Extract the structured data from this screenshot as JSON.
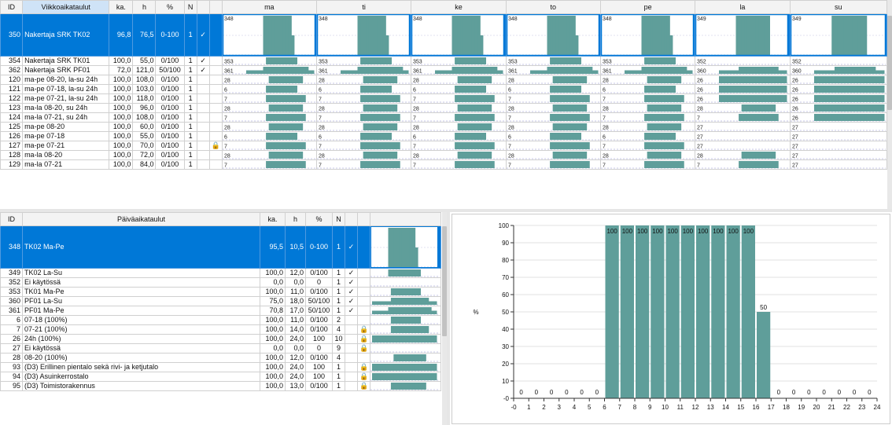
{
  "weekly": {
    "headers": {
      "id": "ID",
      "name": "Viikkoaikataulut",
      "ka": "ka.",
      "h": "h",
      "pct": "%",
      "n": "N"
    },
    "days": [
      "ma",
      "ti",
      "ke",
      "to",
      "pe",
      "la",
      "su"
    ],
    "rows": [
      {
        "id": "350",
        "name": "Nakertaja SRK TK02",
        "ka": "96,8",
        "h": "76,5",
        "pct": "0-100",
        "n": "1",
        "check": "✓",
        "lock": "",
        "dayIds": [
          "348",
          "348",
          "348",
          "348",
          "348",
          "349",
          "349"
        ],
        "patterns": [
          "tk02mp",
          "tk02mp",
          "tk02mp",
          "tk02mp",
          "tk02mp",
          "tk02ls",
          "tk02ls"
        ],
        "selected": true
      },
      {
        "id": "354",
        "name": "Nakertaja SRK TK01",
        "ka": "100,0",
        "h": "55,0",
        "pct": "0/100",
        "n": "1",
        "check": "✓",
        "lock": "",
        "dayIds": [
          "353",
          "353",
          "353",
          "353",
          "353",
          "352",
          "352"
        ],
        "patterns": [
          "tk01",
          "tk01",
          "tk01",
          "tk01",
          "tk01",
          "none",
          "none"
        ]
      },
      {
        "id": "362",
        "name": "Nakertaja SRK PF01",
        "ka": "72,0",
        "h": "121,0",
        "pct": "50/100",
        "n": "1",
        "check": "✓",
        "lock": "",
        "dayIds": [
          "361",
          "361",
          "361",
          "361",
          "361",
          "360",
          "360"
        ],
        "patterns": [
          "pf01mp",
          "pf01mp",
          "pf01mp",
          "pf01mp",
          "pf01mp",
          "pf01ls",
          "pf01ls"
        ]
      },
      {
        "id": "120",
        "name": "ma-pe 08-20, la-su 24h",
        "ka": "100,0",
        "h": "108,0",
        "pct": "0/100",
        "n": "1",
        "check": "",
        "lock": "",
        "dayIds": [
          "28",
          "28",
          "28",
          "28",
          "28",
          "26",
          "26"
        ],
        "patterns": [
          "h0820",
          "h0820",
          "h0820",
          "h0820",
          "h0820",
          "full",
          "full"
        ]
      },
      {
        "id": "121",
        "name": "ma-pe 07-18, la-su 24h",
        "ka": "100,0",
        "h": "103,0",
        "pct": "0/100",
        "n": "1",
        "check": "",
        "lock": "",
        "dayIds": [
          "6",
          "6",
          "6",
          "6",
          "6",
          "26",
          "26"
        ],
        "patterns": [
          "h0718",
          "h0718",
          "h0718",
          "h0718",
          "h0718",
          "full",
          "full"
        ]
      },
      {
        "id": "122",
        "name": "ma-pe 07-21, la-su 24h",
        "ka": "100,0",
        "h": "118,0",
        "pct": "0/100",
        "n": "1",
        "check": "",
        "lock": "",
        "dayIds": [
          "7",
          "7",
          "7",
          "7",
          "7",
          "26",
          "26"
        ],
        "patterns": [
          "h0721",
          "h0721",
          "h0721",
          "h0721",
          "h0721",
          "full",
          "full"
        ]
      },
      {
        "id": "123",
        "name": "ma-la 08-20, su 24h",
        "ka": "100,0",
        "h": "96,0",
        "pct": "0/100",
        "n": "1",
        "check": "",
        "lock": "",
        "dayIds": [
          "28",
          "28",
          "28",
          "28",
          "28",
          "28",
          "26"
        ],
        "patterns": [
          "h0820",
          "h0820",
          "h0820",
          "h0820",
          "h0820",
          "h0820",
          "full"
        ]
      },
      {
        "id": "124",
        "name": "ma-la 07-21, su 24h",
        "ka": "100,0",
        "h": "108,0",
        "pct": "0/100",
        "n": "1",
        "check": "",
        "lock": "",
        "dayIds": [
          "7",
          "7",
          "7",
          "7",
          "7",
          "7",
          "26"
        ],
        "patterns": [
          "h0721",
          "h0721",
          "h0721",
          "h0721",
          "h0721",
          "h0721",
          "full"
        ]
      },
      {
        "id": "125",
        "name": "ma-pe 08-20",
        "ka": "100,0",
        "h": "60,0",
        "pct": "0/100",
        "n": "1",
        "check": "",
        "lock": "",
        "dayIds": [
          "28",
          "28",
          "28",
          "28",
          "28",
          "27",
          "27"
        ],
        "patterns": [
          "h0820",
          "h0820",
          "h0820",
          "h0820",
          "h0820",
          "none",
          "none"
        ]
      },
      {
        "id": "126",
        "name": "ma-pe 07-18",
        "ka": "100,0",
        "h": "55,0",
        "pct": "0/100",
        "n": "1",
        "check": "",
        "lock": "",
        "dayIds": [
          "6",
          "6",
          "6",
          "6",
          "6",
          "27",
          "27"
        ],
        "patterns": [
          "h0718",
          "h0718",
          "h0718",
          "h0718",
          "h0718",
          "none",
          "none"
        ]
      },
      {
        "id": "127",
        "name": "ma-pe 07-21",
        "ka": "100,0",
        "h": "70,0",
        "pct": "0/100",
        "n": "1",
        "check": "",
        "lock": "🔒",
        "dayIds": [
          "7",
          "7",
          "7",
          "7",
          "7",
          "27",
          "27"
        ],
        "patterns": [
          "h0721",
          "h0721",
          "h0721",
          "h0721",
          "h0721",
          "none",
          "none"
        ]
      },
      {
        "id": "128",
        "name": "ma-la 08-20",
        "ka": "100,0",
        "h": "72,0",
        "pct": "0/100",
        "n": "1",
        "check": "",
        "lock": "",
        "dayIds": [
          "28",
          "28",
          "28",
          "28",
          "28",
          "28",
          "27"
        ],
        "patterns": [
          "h0820",
          "h0820",
          "h0820",
          "h0820",
          "h0820",
          "h0820",
          "none"
        ]
      },
      {
        "id": "129",
        "name": "ma-la 07-21",
        "ka": "100,0",
        "h": "84,0",
        "pct": "0/100",
        "n": "1",
        "check": "",
        "lock": "",
        "dayIds": [
          "7",
          "7",
          "7",
          "7",
          "7",
          "7",
          "27"
        ],
        "patterns": [
          "h0721",
          "h0721",
          "h0721",
          "h0721",
          "h0721",
          "h0721",
          "none"
        ]
      }
    ]
  },
  "daily": {
    "headers": {
      "id": "ID",
      "name": "Päiväaikataulut",
      "ka": "ka.",
      "h": "h",
      "pct": "%",
      "n": "N"
    },
    "rows": [
      {
        "id": "348",
        "name": "TK02 Ma-Pe",
        "ka": "95,5",
        "h": "10,5",
        "pct": "0-100",
        "n": "1",
        "check": "✓",
        "lock": "",
        "pattern": "tk02mp",
        "selected": true
      },
      {
        "id": "349",
        "name": "TK02 La-Su",
        "ka": "100,0",
        "h": "12,0",
        "pct": "0/100",
        "n": "1",
        "check": "✓",
        "lock": "",
        "pattern": "tk02ls"
      },
      {
        "id": "352",
        "name": "Ei käytössä",
        "ka": "0,0",
        "h": "0,0",
        "pct": "0",
        "n": "1",
        "check": "✓",
        "lock": "",
        "pattern": "none"
      },
      {
        "id": "353",
        "name": "TK01 Ma-Pe",
        "ka": "100,0",
        "h": "11,0",
        "pct": "0/100",
        "n": "1",
        "check": "✓",
        "lock": "",
        "pattern": "tk01"
      },
      {
        "id": "360",
        "name": "PF01 La-Su",
        "ka": "75,0",
        "h": "18,0",
        "pct": "50/100",
        "n": "1",
        "check": "✓",
        "lock": "",
        "pattern": "pf01ls"
      },
      {
        "id": "361",
        "name": "PF01 Ma-Pe",
        "ka": "70,8",
        "h": "17,0",
        "pct": "50/100",
        "n": "1",
        "check": "✓",
        "lock": "",
        "pattern": "pf01mp"
      },
      {
        "id": "6",
        "name": "07-18 (100%)",
        "ka": "100,0",
        "h": "11,0",
        "pct": "0/100",
        "n": "2",
        "check": "",
        "lock": "",
        "pattern": "h0718"
      },
      {
        "id": "7",
        "name": "07-21 (100%)",
        "ka": "100,0",
        "h": "14,0",
        "pct": "0/100",
        "n": "4",
        "check": "",
        "lock": "🔒",
        "pattern": "h0721"
      },
      {
        "id": "26",
        "name": "24h (100%)",
        "ka": "100,0",
        "h": "24,0",
        "pct": "100",
        "n": "10",
        "check": "",
        "lock": "🔒",
        "pattern": "full"
      },
      {
        "id": "27",
        "name": "Ei käytössä",
        "ka": "0,0",
        "h": "0,0",
        "pct": "0",
        "n": "9",
        "check": "",
        "lock": "🔒",
        "pattern": "none"
      },
      {
        "id": "28",
        "name": "08-20 (100%)",
        "ka": "100,0",
        "h": "12,0",
        "pct": "0/100",
        "n": "4",
        "check": "",
        "lock": "",
        "pattern": "h0820"
      },
      {
        "id": "93",
        "name": "(D3) Erillinen pientalo sekä rivi- ja ketjutalo",
        "ka": "100,0",
        "h": "24,0",
        "pct": "100",
        "n": "1",
        "check": "",
        "lock": "🔒",
        "pattern": "full"
      },
      {
        "id": "94",
        "name": "(D3) Asuinkerrostalo",
        "ka": "100,0",
        "h": "24,0",
        "pct": "100",
        "n": "1",
        "check": "",
        "lock": "🔒",
        "pattern": "full"
      },
      {
        "id": "95",
        "name": "(D3) Toimistorakennus",
        "ka": "100,0",
        "h": "13,0",
        "pct": "0/100",
        "n": "1",
        "check": "",
        "lock": "🔒",
        "pattern": "h0720"
      }
    ]
  },
  "chart_data": {
    "type": "bar",
    "title": "",
    "xlabel": "",
    "ylabel": "%",
    "categories": [
      0,
      1,
      2,
      3,
      4,
      5,
      6,
      7,
      8,
      9,
      10,
      11,
      12,
      13,
      14,
      15,
      16,
      17,
      18,
      19,
      20,
      21,
      22,
      23
    ],
    "values": [
      0,
      0,
      0,
      0,
      0,
      0,
      100,
      100,
      100,
      100,
      100,
      100,
      100,
      100,
      100,
      100,
      50,
      0,
      0,
      0,
      0,
      0,
      0,
      0
    ],
    "xticks": [
      "-0",
      "1",
      "2",
      "3",
      "4",
      "5",
      "6",
      "7",
      "8",
      "9",
      "10",
      "11",
      "12",
      "13",
      "14",
      "15",
      "16",
      "17",
      "18",
      "19",
      "20",
      "21",
      "22",
      "23",
      "24"
    ],
    "yticks": [
      "-0",
      "10",
      "20",
      "30",
      "40",
      "50",
      "60",
      "70",
      "80",
      "90",
      "100"
    ],
    "xlim": [
      0,
      24
    ],
    "ylim": [
      0,
      100
    ],
    "grid": true,
    "color": "#5f9e9a"
  },
  "colors": {
    "bar": "#5f9e9a",
    "selected": "#0078d7",
    "headerHighlight": "#cfe3f7"
  },
  "patterns": {
    "tk02mp": [
      0,
      0,
      0,
      0,
      0,
      0,
      100,
      100,
      100,
      100,
      100,
      100,
      100,
      100,
      100,
      100,
      50,
      0,
      0,
      0,
      0,
      0,
      0,
      0
    ],
    "tk02ls": [
      0,
      0,
      0,
      0,
      0,
      0,
      100,
      100,
      100,
      100,
      100,
      100,
      100,
      100,
      100,
      100,
      100,
      100,
      0,
      0,
      0,
      0,
      0,
      0
    ],
    "tk01": [
      0,
      0,
      0,
      0,
      0,
      0,
      0,
      100,
      100,
      100,
      100,
      100,
      100,
      100,
      100,
      100,
      100,
      100,
      0,
      0,
      0,
      0,
      0,
      0
    ],
    "pf01mp": [
      50,
      50,
      50,
      50,
      50,
      50,
      100,
      100,
      100,
      100,
      100,
      100,
      100,
      100,
      100,
      100,
      100,
      100,
      100,
      100,
      100,
      100,
      50,
      50
    ],
    "pf01ls": [
      50,
      50,
      50,
      50,
      50,
      50,
      50,
      100,
      100,
      100,
      100,
      100,
      100,
      100,
      100,
      100,
      100,
      100,
      100,
      100,
      100,
      50,
      50,
      50
    ],
    "h0820": [
      0,
      0,
      0,
      0,
      0,
      0,
      0,
      0,
      100,
      100,
      100,
      100,
      100,
      100,
      100,
      100,
      100,
      100,
      100,
      100,
      0,
      0,
      0,
      0
    ],
    "h0718": [
      0,
      0,
      0,
      0,
      0,
      0,
      0,
      100,
      100,
      100,
      100,
      100,
      100,
      100,
      100,
      100,
      100,
      100,
      0,
      0,
      0,
      0,
      0,
      0
    ],
    "h0721": [
      0,
      0,
      0,
      0,
      0,
      0,
      0,
      100,
      100,
      100,
      100,
      100,
      100,
      100,
      100,
      100,
      100,
      100,
      100,
      100,
      100,
      0,
      0,
      0
    ],
    "h0720": [
      0,
      0,
      0,
      0,
      0,
      0,
      0,
      100,
      100,
      100,
      100,
      100,
      100,
      100,
      100,
      100,
      100,
      100,
      100,
      100,
      0,
      0,
      0,
      0
    ],
    "full": [
      100,
      100,
      100,
      100,
      100,
      100,
      100,
      100,
      100,
      100,
      100,
      100,
      100,
      100,
      100,
      100,
      100,
      100,
      100,
      100,
      100,
      100,
      100,
      100
    ],
    "none": [
      0,
      0,
      0,
      0,
      0,
      0,
      0,
      0,
      0,
      0,
      0,
      0,
      0,
      0,
      0,
      0,
      0,
      0,
      0,
      0,
      0,
      0,
      0,
      0
    ]
  }
}
